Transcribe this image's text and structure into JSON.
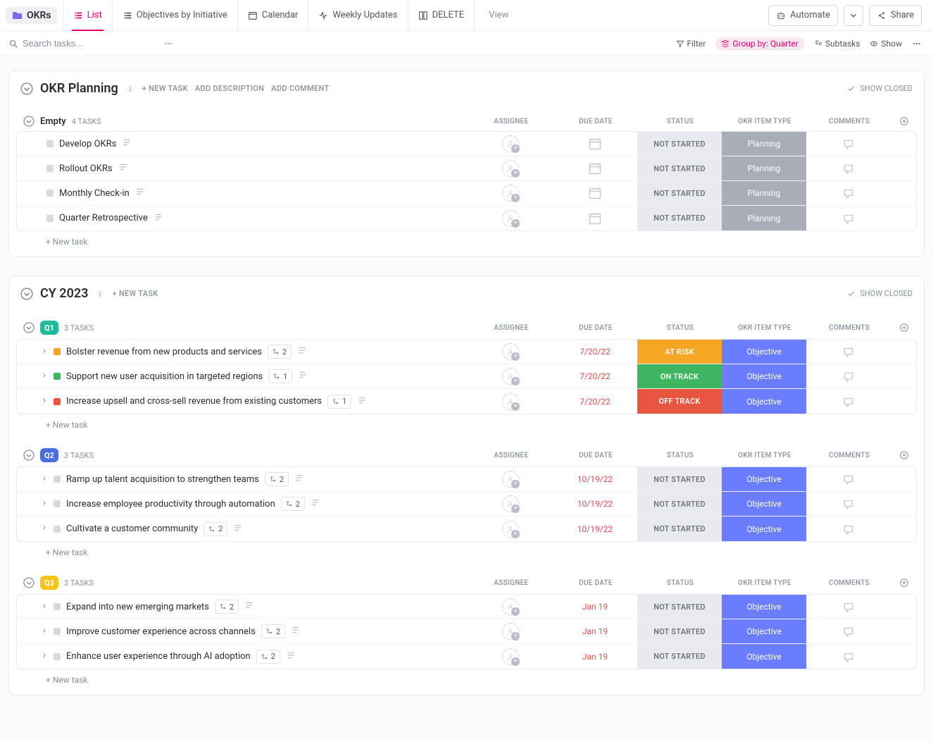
{
  "topbar": {
    "folder": "OKRs",
    "tabs": [
      {
        "label": "List",
        "active": true
      },
      {
        "label": "Objectives by Initiative"
      },
      {
        "label": "Calendar"
      },
      {
        "label": "Weekly Updates"
      },
      {
        "label": "DELETE"
      }
    ],
    "add_view": "View",
    "automate": "Automate",
    "share": "Share"
  },
  "filterbar": {
    "search_placeholder": "Search tasks...",
    "filter": "Filter",
    "group_by": "Group by: Quarter",
    "subtasks": "Subtasks",
    "show": "Show"
  },
  "columns": [
    "ASSIGNEE",
    "DUE DATE",
    "STATUS",
    "OKR ITEM TYPE",
    "COMMENTS"
  ],
  "sections": [
    {
      "title": "OKR Planning",
      "add_desc": "ADD DESCRIPTION",
      "add_comment": "ADD COMMENT",
      "new_task": "+ NEW TASK",
      "show_closed": "SHOW CLOSED",
      "groups": [
        {
          "name": "Empty",
          "count": "4 TASKS",
          "rows": [
            {
              "title": "Develop OKRs",
              "has_desc": true,
              "status": "NOT STARTED",
              "status_cls": "status-notstarted",
              "type": "Planning",
              "type_cls": "type-planning",
              "date_ph": true
            },
            {
              "title": "Rollout OKRs",
              "has_desc": true,
              "status": "NOT STARTED",
              "status_cls": "status-notstarted",
              "type": "Planning",
              "type_cls": "type-planning",
              "date_ph": true
            },
            {
              "title": "Monthly Check-in",
              "has_desc": true,
              "status": "NOT STARTED",
              "status_cls": "status-notstarted",
              "type": "Planning",
              "type_cls": "type-planning",
              "date_ph": true
            },
            {
              "title": "Quarter Retrospective",
              "has_desc": true,
              "status": "NOT STARTED",
              "status_cls": "status-notstarted",
              "type": "Planning",
              "type_cls": "type-planning",
              "date_ph": true
            }
          ],
          "new_task_row": "+ New task"
        }
      ]
    },
    {
      "title": "CY 2023",
      "new_task": "+ NEW TASK",
      "show_closed": "SHOW CLOSED",
      "groups": [
        {
          "badge": "Q1",
          "badge_bg": "#1abc9c",
          "caret_cls": "q1-caret",
          "count": "3 TASKS",
          "rows": [
            {
              "title": "Bolster revenue from new products and services",
              "sub": 2,
              "has_desc": true,
              "status": "AT RISK",
              "status_cls": "status-atrisk",
              "type": "Objective",
              "type_cls": "type-objective",
              "date": "7/20/22",
              "sq": "#f5a623",
              "caret": true
            },
            {
              "title": "Support new user acquisition in targeted regions",
              "sub": 1,
              "has_desc": true,
              "status": "ON TRACK",
              "status_cls": "status-ontrack",
              "type": "Objective",
              "type_cls": "type-objective",
              "date": "7/20/22",
              "sq": "#3db65f",
              "caret": true
            },
            {
              "title": "Increase upsell and cross-sell revenue from existing customers",
              "sub": 1,
              "has_desc": true,
              "status": "OFF TRACK",
              "status_cls": "status-offtrack",
              "type": "Objective",
              "type_cls": "type-objective",
              "date": "7/20/22",
              "sq": "#e85642",
              "caret": true
            }
          ],
          "new_task_row": "+ New task"
        },
        {
          "badge": "Q2",
          "badge_bg": "#4a6ee0",
          "caret_cls": "q2-caret",
          "count": "3 TASKS",
          "rows": [
            {
              "title": "Ramp up talent acquisition to strengthen teams",
              "sub": 2,
              "has_desc": true,
              "status": "NOT STARTED",
              "status_cls": "status-notstarted",
              "type": "Objective",
              "type_cls": "type-objective",
              "date": "10/19/22",
              "sq": "#d6d9de",
              "caret": true
            },
            {
              "title": "Increase employee productivity through automation",
              "sub": 2,
              "has_desc": true,
              "status": "NOT STARTED",
              "status_cls": "status-notstarted",
              "type": "Objective",
              "type_cls": "type-objective",
              "date": "10/19/22",
              "sq": "#d6d9de",
              "caret": true
            },
            {
              "title": "Cultivate a customer community",
              "sub": 2,
              "has_desc": true,
              "status": "NOT STARTED",
              "status_cls": "status-notstarted",
              "type": "Objective",
              "type_cls": "type-objective",
              "date": "10/19/22",
              "sq": "#d6d9de",
              "caret": true
            }
          ],
          "new_task_row": "+ New task"
        },
        {
          "badge": "Q3",
          "badge_bg": "#f5c518",
          "caret_cls": "q3-caret",
          "count": "3 TASKS",
          "rows": [
            {
              "title": "Expand into new emerging markets",
              "sub": 2,
              "has_desc": true,
              "status": "NOT STARTED",
              "status_cls": "status-notstarted",
              "type": "Objective",
              "type_cls": "type-objective",
              "date": "Jan 19",
              "sq": "#d6d9de",
              "caret": true
            },
            {
              "title": "Improve customer experience across channels",
              "sub": 2,
              "has_desc": true,
              "status": "NOT STARTED",
              "status_cls": "status-notstarted",
              "type": "Objective",
              "type_cls": "type-objective",
              "date": "Jan 19",
              "sq": "#d6d9de",
              "caret": true
            },
            {
              "title": "Enhance user experience through AI adoption",
              "sub": 2,
              "has_desc": true,
              "status": "NOT STARTED",
              "status_cls": "status-notstarted",
              "type": "Objective",
              "type_cls": "type-objective",
              "date": "Jan 19",
              "sq": "#d6d9de",
              "caret": true
            }
          ],
          "new_task_row": "+ New task"
        }
      ]
    }
  ]
}
